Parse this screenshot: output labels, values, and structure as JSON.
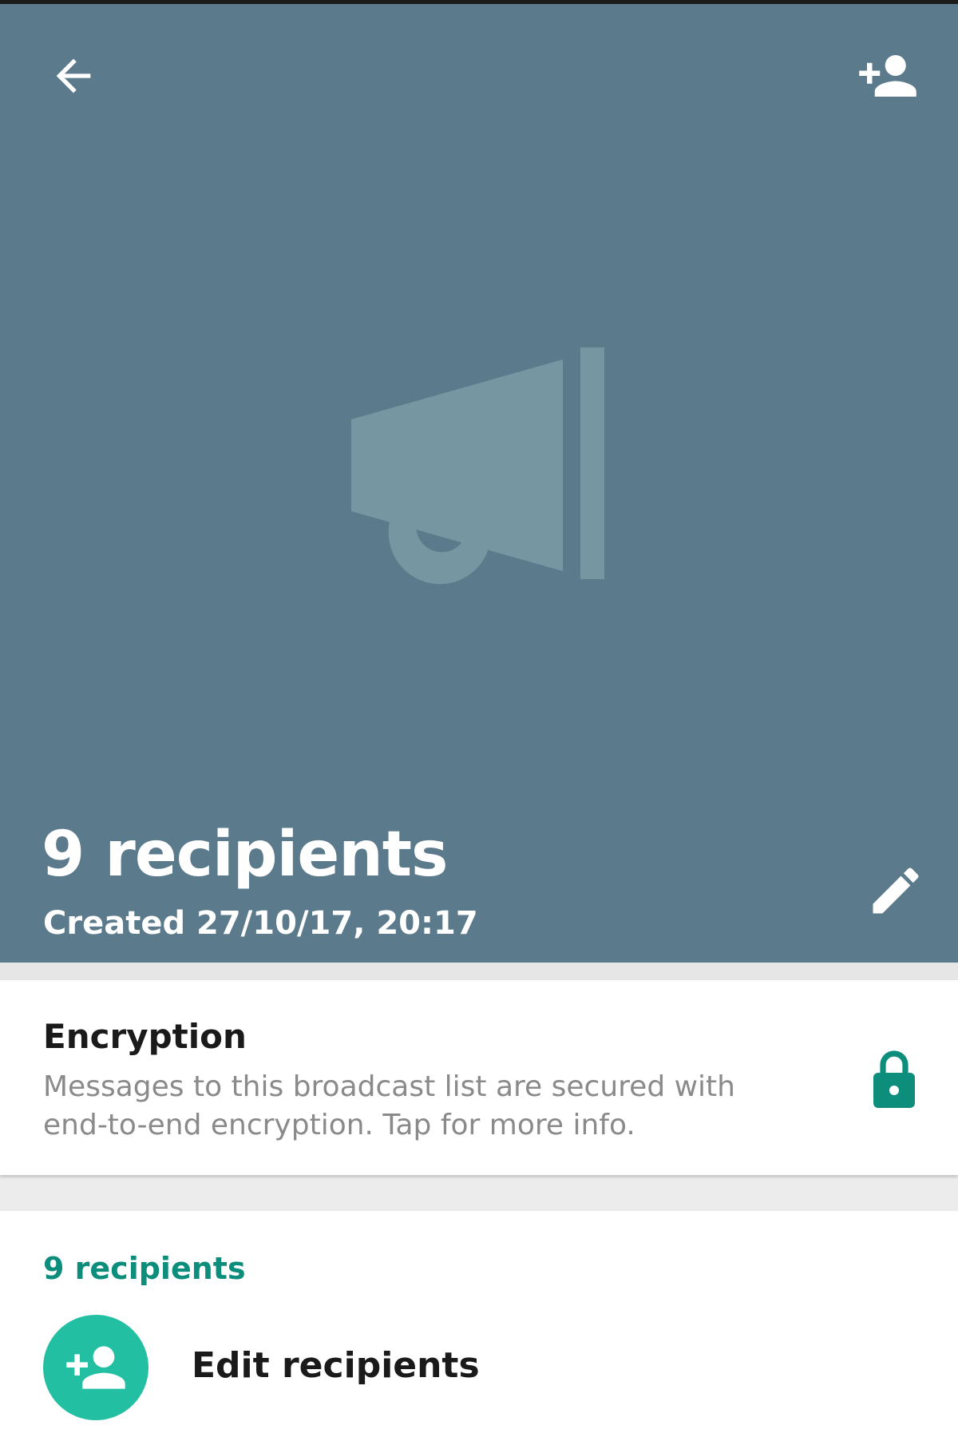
{
  "header": {
    "title": "9 recipients",
    "subtitle": "Created 27/10/17, 20:17",
    "background_color": "#5b7b8c",
    "icons": {
      "back": "arrow-left-icon",
      "add_recipient": "person-add-icon",
      "edit": "pencil-icon",
      "placeholder": "megaphone-icon"
    }
  },
  "encryption": {
    "title": "Encryption",
    "description": "Messages to this broadcast list are secured with end-to-end encryption. Tap for more info.",
    "icon": "lock-icon",
    "icon_color": "#0d8d7b"
  },
  "recipients": {
    "section_label": "9 recipients",
    "edit_label": "Edit recipients",
    "accent_color": "#22bfa2"
  }
}
